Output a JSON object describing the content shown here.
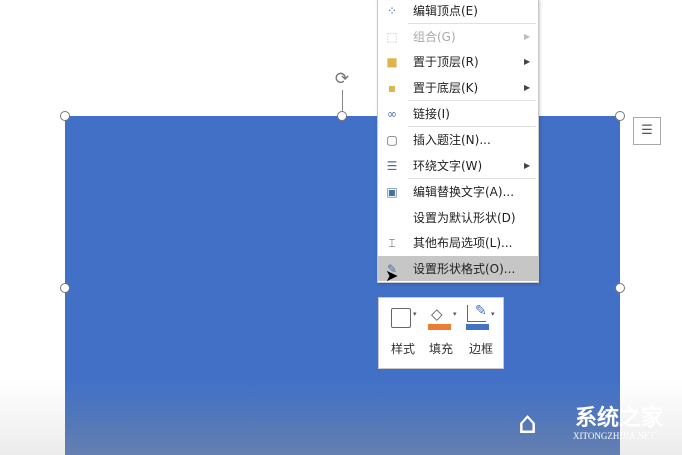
{
  "menu": {
    "items": [
      {
        "icon": "edit-points-icon",
        "label": "编辑顶点(E)",
        "submenu": false,
        "disabled": false
      },
      {
        "icon": "group-icon",
        "label": "组合(G)",
        "submenu": true,
        "disabled": true
      },
      {
        "icon": "bring-to-front-icon",
        "label": "置于顶层(R)",
        "submenu": true,
        "disabled": false
      },
      {
        "icon": "send-to-back-icon",
        "label": "置于底层(K)",
        "submenu": true,
        "disabled": false
      },
      {
        "icon": "link-icon",
        "label": "链接(I)",
        "submenu": false,
        "disabled": false
      },
      {
        "icon": "insert-caption-icon",
        "label": "插入题注(N)...",
        "submenu": false,
        "disabled": false
      },
      {
        "icon": "wrap-text-icon",
        "label": "环绕文字(W)",
        "submenu": true,
        "disabled": false
      },
      {
        "icon": "alt-text-icon",
        "label": "编辑替换文字(A)...",
        "submenu": false,
        "disabled": false
      },
      {
        "icon": "",
        "label": "设置为默认形状(D)",
        "submenu": false,
        "disabled": false
      },
      {
        "icon": "layout-options-icon",
        "label": "其他布局选项(L)...",
        "submenu": false,
        "disabled": false
      },
      {
        "icon": "format-shape-icon",
        "label": "设置形状格式(O)...",
        "submenu": false,
        "disabled": false,
        "highlighted": true
      }
    ]
  },
  "toolbar": {
    "style": "样式",
    "fill": "填充",
    "outline": "边框"
  },
  "colors": {
    "shape": "#4170c6",
    "fill_accent": "#ed7d31",
    "outline_accent": "#4472c4"
  },
  "watermark": {
    "title": "系统之家",
    "url": "XITONGZHIJIA.NET"
  }
}
